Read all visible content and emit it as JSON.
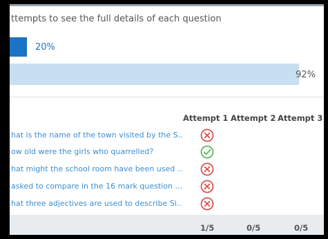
{
  "instructions": "ttempts to see the full details of each question",
  "summary_bars": [
    {
      "label": "20%",
      "fraction": 0.09
    },
    {
      "label": "92%",
      "fraction": 0.92
    }
  ],
  "table": {
    "headers": [
      "Attempt 1",
      "Attempt 2",
      "Attempt 3"
    ],
    "questions": [
      {
        "text": "hat is the name of the town visited by the S...",
        "attempt1": "incorrect"
      },
      {
        "text": "ow old were the girls who quarrelled?",
        "attempt1": "correct"
      },
      {
        "text": "hat might the school room have been used ...",
        "attempt1": "incorrect"
      },
      {
        "text": "asked to compare in the 16 mark question ...",
        "attempt1": "incorrect"
      },
      {
        "text": "hat three adjectives are used to describe Si...",
        "attempt1": "incorrect"
      }
    ],
    "totals": [
      "1/5",
      "0/5",
      "0/5"
    ]
  },
  "colors": {
    "accent": "#1a73c4",
    "bar_light": "#c7dff1",
    "link": "#3b8ed3",
    "incorrect": "#d9534f",
    "correct": "#5cb85c",
    "footer_bg": "#e9ecef"
  },
  "icons": {
    "incorrect": "x-circle-icon",
    "correct": "check-circle-icon"
  }
}
